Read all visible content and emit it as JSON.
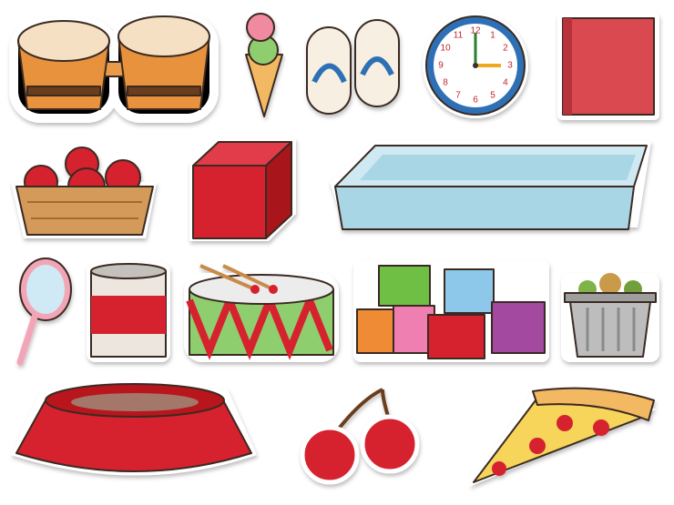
{
  "clock": {
    "numerals": [
      "12",
      "1",
      "2",
      "3",
      "4",
      "5",
      "6",
      "7",
      "8",
      "9",
      "10",
      "11"
    ],
    "time_shown": "3:00"
  },
  "colors": {
    "background": "#ffffff",
    "sticker_border": "#ffffff",
    "red": "#d6202e",
    "clock_rim": "#2f6fb5",
    "tray_water": "#a9d6e5"
  }
}
